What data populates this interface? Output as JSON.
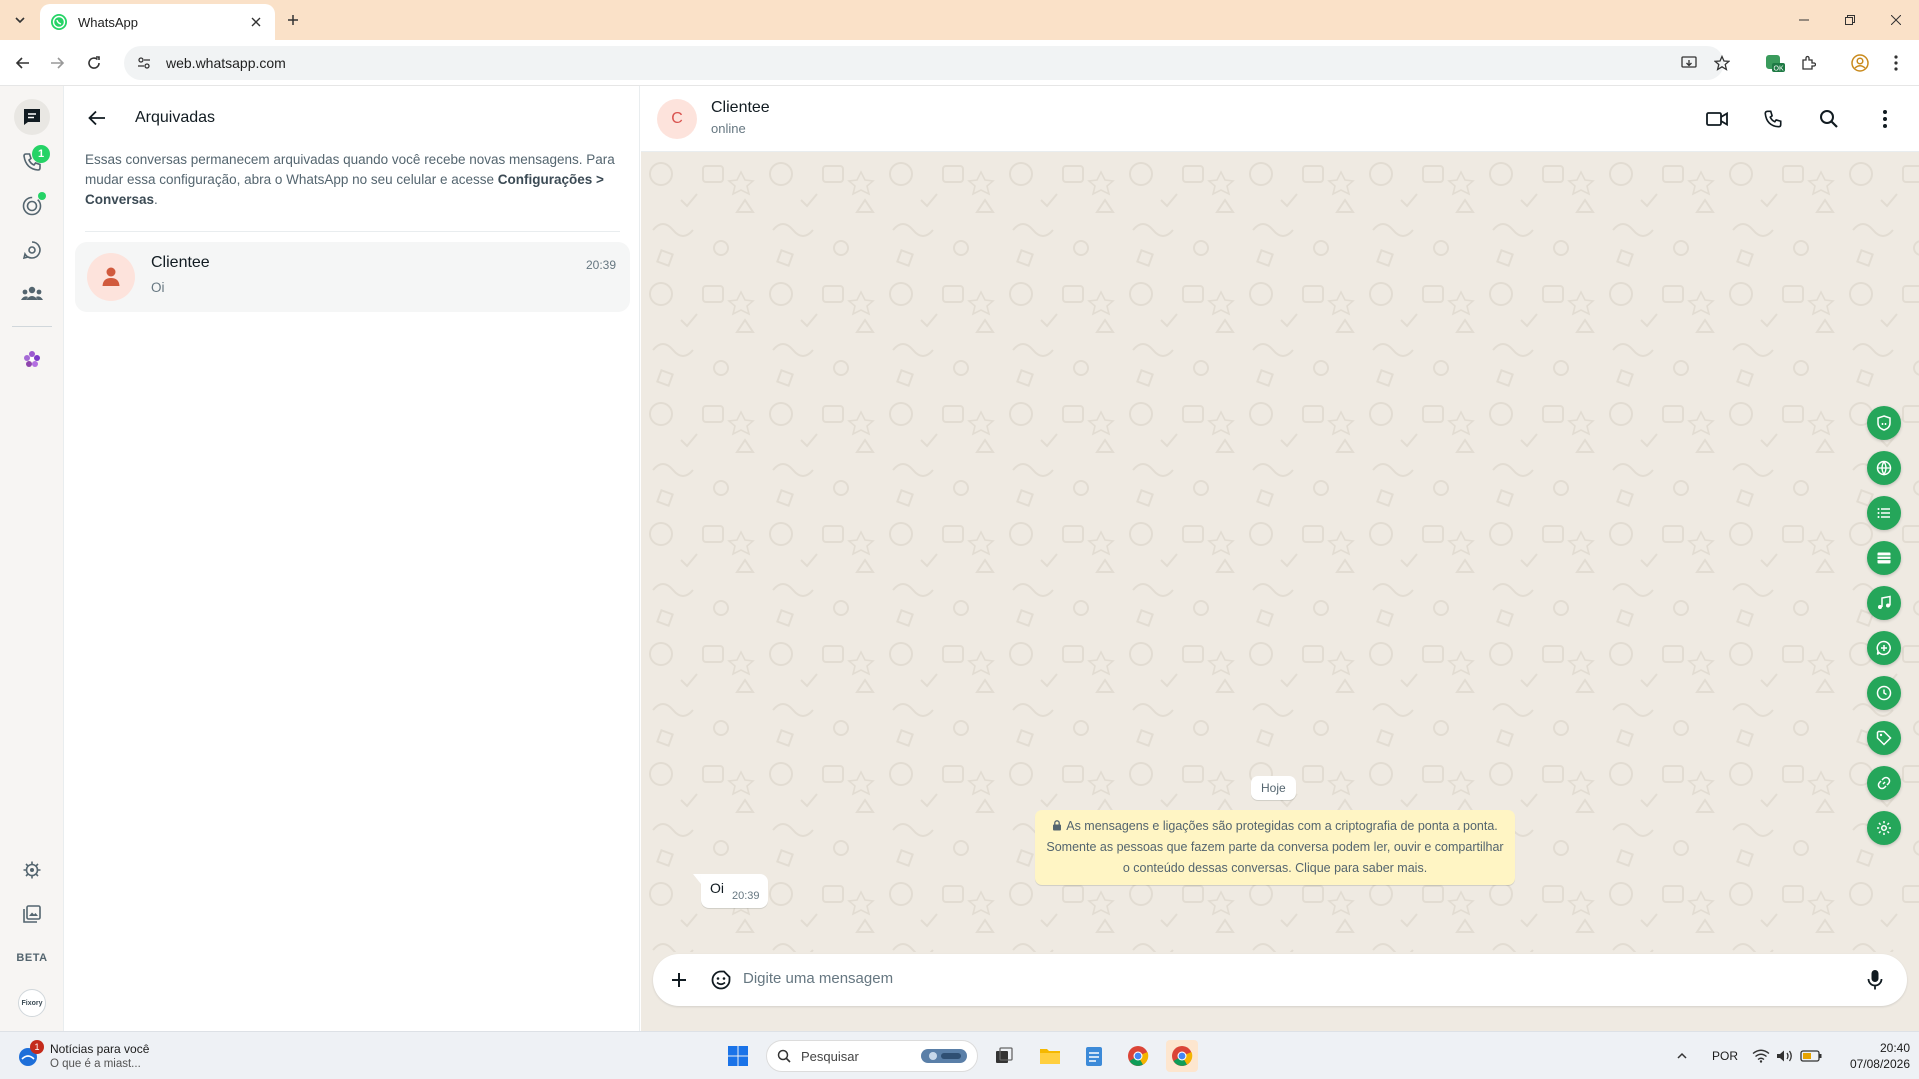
{
  "browser": {
    "tab_title": "WhatsApp",
    "url": "web.whatsapp.com"
  },
  "rail": {
    "calls_badge": "1",
    "beta_label": "BETA",
    "avatar_text": "Fixory"
  },
  "archived": {
    "title": "Arquivadas",
    "info_text": "Essas conversas permanecem arquivadas quando você recebe novas mensagens. Para mudar essa configuração, abra o WhatsApp no seu celular e acesse ",
    "info_bold": "Configurações > Conversas",
    "info_end": ".",
    "chats": [
      {
        "name": "Clientee",
        "last_message": "Oi",
        "time": "20:39"
      }
    ]
  },
  "conversation": {
    "contact_initial": "C",
    "contact_name": "Clientee",
    "status": "online",
    "day_chip": "Hoje",
    "e2e_notice": "As mensagens e ligações são protegidas com a criptografia de ponta a ponta. Somente as pessoas que fazem parte da conversa podem ler, ouvir e compartilhar o conteúdo dessas conversas. Clique para saber mais.",
    "messages": [
      {
        "text": "Oi",
        "time": "20:39",
        "direction": "in"
      }
    ],
    "compose_placeholder": "Digite uma mensagem"
  },
  "side_tools": [
    "shield-icon",
    "globe-icon",
    "list-icon",
    "table-icon",
    "music-icon",
    "chat-plus-icon",
    "clock-icon",
    "tag-icon",
    "link-icon",
    "gear-icon"
  ],
  "taskbar": {
    "news_badge": "1",
    "news_title": "Notícias para você",
    "news_subtitle": "O que é a miast...",
    "search_placeholder": "Pesquisar",
    "lang": "POR",
    "time": "20:40",
    "date": "07/08/2026"
  },
  "colors": {
    "accent_green": "#25a65a",
    "tab_bar": "#fae1c8",
    "wallpaper": "#efeae2",
    "notice_yellow": "#fff5c4"
  }
}
